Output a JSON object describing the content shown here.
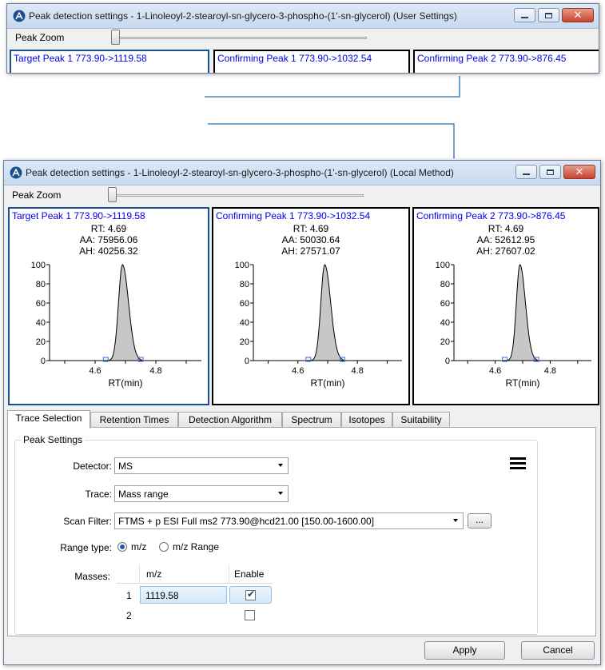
{
  "colors": {
    "accent": "#1a4f8f",
    "panel_title": "#0000e6",
    "callout_line": "#1f6fb5"
  },
  "top_window": {
    "title": "Peak detection settings - 1-Linoleoyl-2-stearoyl-sn-glycero-3-phospho-(1'-sn-glycerol)  (User Settings)",
    "zoom_label": "Peak Zoom",
    "panels": [
      "Target Peak 1  773.90->1119.58",
      "Confirming Peak 1  773.90->1032.54",
      "Confirming Peak 2  773.90->876.45"
    ]
  },
  "window": {
    "title": "Peak detection settings - 1-Linoleoyl-2-stearoyl-sn-glycero-3-phospho-(1'-sn-glycerol) (Local Method)",
    "zoom_label": "Peak Zoom"
  },
  "peaks": [
    {
      "title": "Target Peak 1  773.90->1119.58",
      "rt": "RT: 4.69",
      "aa": "AA: 75956.06",
      "ah": "AH: 40256.32"
    },
    {
      "title": "Confirming Peak 1  773.90->1032.54",
      "rt": "RT: 4.69",
      "aa": "AA: 50030.64",
      "ah": "AH: 27571.07"
    },
    {
      "title": "Confirming Peak 2  773.90->876.45",
      "rt": "RT: 4.69",
      "aa": "AA: 52612.95",
      "ah": "AH: 27607.02"
    }
  ],
  "chart_data": {
    "type": "line",
    "xlabel": "RT(min)",
    "y_ticks": [
      "100",
      "80",
      "60",
      "40",
      "20",
      "0"
    ],
    "x_ticks": [
      "4.6",
      "4.8"
    ],
    "xlim": [
      4.45,
      4.95
    ],
    "ylim": [
      0,
      100
    ],
    "peak_apex": 4.69
  },
  "tabs": [
    "Trace Selection",
    "Retention Times",
    "Detection Algorithm",
    "Spectrum",
    "Isotopes",
    "Suitability"
  ],
  "settings": {
    "group_label": "Peak Settings",
    "detector_label": "Detector:",
    "detector_value": "MS",
    "trace_label": "Trace:",
    "trace_value": "Mass range",
    "scan_filter_label": "Scan Filter:",
    "scan_filter_value": "FTMS + p ESI Full ms2 773.90@hcd21.00 [150.00-1600.00]",
    "browse_label": "...",
    "range_type_label": "Range type:",
    "range_opt1": "m/z",
    "range_opt2": "m/z Range",
    "masses_label": "Masses:",
    "col_mz": "m/z",
    "col_enable": "Enable",
    "rows": [
      {
        "index": "1",
        "mz": "1119.58",
        "enabled": true
      },
      {
        "index": "2",
        "mz": "",
        "enabled": false
      }
    ]
  },
  "buttons": {
    "apply": "Apply",
    "cancel": "Cancel"
  }
}
